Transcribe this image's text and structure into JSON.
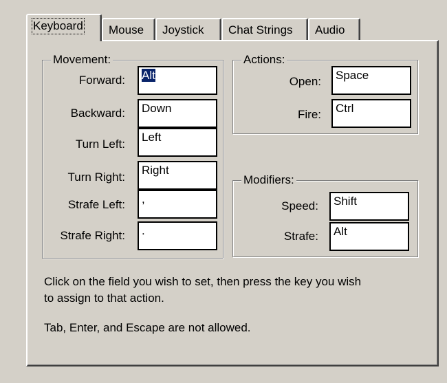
{
  "tabs": [
    {
      "label": "Keyboard",
      "active": true
    },
    {
      "label": "Mouse",
      "active": false
    },
    {
      "label": "Joystick",
      "active": false
    },
    {
      "label": "Chat Strings",
      "active": false
    },
    {
      "label": "Audio",
      "active": false
    }
  ],
  "movement": {
    "title": "Movement:",
    "rows": [
      {
        "label": "Forward:",
        "value": "Alt",
        "selected": true
      },
      {
        "label": "Backward:",
        "value": "Down"
      },
      {
        "label": "Turn Left:",
        "value": "Left"
      },
      {
        "label": "Turn Right:",
        "value": "Right"
      },
      {
        "label": "Strafe Left:",
        "value": ","
      },
      {
        "label": "Strafe Right:",
        "value": "."
      }
    ]
  },
  "actions": {
    "title": "Actions:",
    "rows": [
      {
        "label": "Open:",
        "value": "Space"
      },
      {
        "label": "Fire:",
        "value": "Ctrl"
      }
    ]
  },
  "modifiers": {
    "title": "Modifiers:",
    "rows": [
      {
        "label": "Speed:",
        "value": "Shift"
      },
      {
        "label": "Strafe:",
        "value": "Alt"
      }
    ]
  },
  "help": {
    "line1": "Click on the field you wish to set, then press the key you wish",
    "line2": "to assign to that action.",
    "line3": "Tab, Enter, and Escape are not allowed."
  },
  "colors": {
    "face": "#d4d0c8",
    "selection": "#0a246a"
  }
}
